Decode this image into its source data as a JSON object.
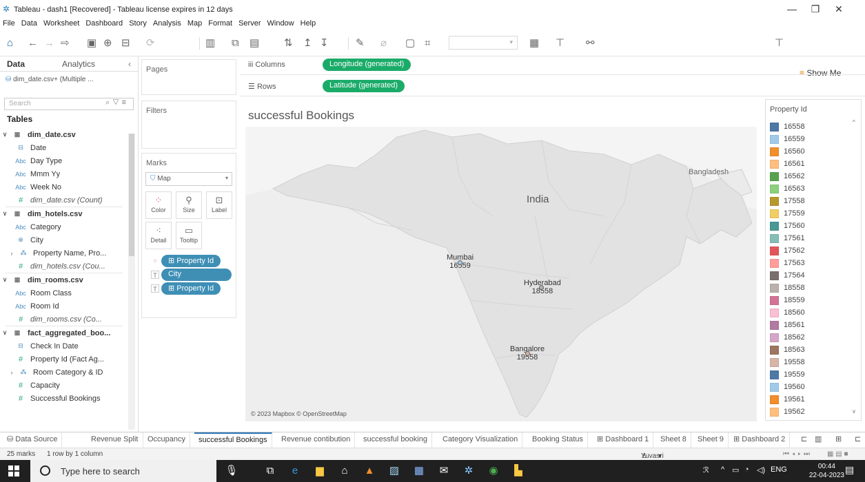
{
  "window": {
    "title": "Tableau - dash1 [Recovered] - Tableau license expires in 12 days"
  },
  "menu": [
    "File",
    "Data",
    "Worksheet",
    "Dashboard",
    "Story",
    "Analysis",
    "Map",
    "Format",
    "Server",
    "Window",
    "Help"
  ],
  "toolbar": {
    "show_me": "Show Me"
  },
  "data_pane": {
    "tab_data": "Data",
    "tab_analytics": "Analytics",
    "datasource": "dim_date.csv+ (Multiple ...",
    "search_placeholder": "Search",
    "tables_heading": "Tables"
  },
  "fields": [
    {
      "kind": "table",
      "label": "dim_date.csv",
      "chev": "∨"
    },
    {
      "kind": "date",
      "label": "Date"
    },
    {
      "kind": "dim",
      "label": "Day Type"
    },
    {
      "kind": "dim",
      "label": "Mmm Yy"
    },
    {
      "kind": "dim",
      "label": "Week No"
    },
    {
      "kind": "count",
      "label": "dim_date.csv (Count)"
    },
    {
      "kind": "table",
      "label": "dim_hotels.csv",
      "chev": "∨"
    },
    {
      "kind": "dim",
      "label": "Category"
    },
    {
      "kind": "geo",
      "label": "City"
    },
    {
      "kind": "hier",
      "label": "Property Name, Pro...",
      "chev": "›"
    },
    {
      "kind": "count",
      "label": "dim_hotels.csv (Cou..."
    },
    {
      "kind": "table",
      "label": "dim_rooms.csv",
      "chev": "∨"
    },
    {
      "kind": "dim",
      "label": "Room Class"
    },
    {
      "kind": "dim",
      "label": "Room Id"
    },
    {
      "kind": "count",
      "label": "dim_rooms.csv (Co..."
    },
    {
      "kind": "table",
      "label": "fact_aggregated_boo...",
      "chev": "∨"
    },
    {
      "kind": "date",
      "label": "Check In Date"
    },
    {
      "kind": "meas",
      "label": "Property Id (Fact Ag..."
    },
    {
      "kind": "hier",
      "label": "Room Category & ID",
      "chev": "›"
    },
    {
      "kind": "meas",
      "label": "Capacity"
    },
    {
      "kind": "meas",
      "label": "Successful Bookings"
    }
  ],
  "shelves": {
    "pages": "Pages",
    "filters": "Filters",
    "marks": "Marks",
    "mark_type": "Map",
    "color": "Color",
    "size": "Size",
    "label": "Label",
    "detail": "Detail",
    "tooltip": "Tooltip",
    "mark_pills": [
      "Property Id",
      "City",
      "Property Id"
    ],
    "columns_label": "Columns",
    "rows_label": "Rows",
    "columns_pill": "Longitude (generated)",
    "rows_pill": "Latitude (generated)"
  },
  "sheet": {
    "title": "successful Bookings",
    "credit": "© 2023 Mapbox © OpenStreetMap",
    "map_labels": {
      "country": "India",
      "neighbor": "Bangladesh"
    },
    "cities": [
      {
        "name": "Mumbai",
        "id": "16559"
      },
      {
        "name": "Hyderabad",
        "id": "18558"
      },
      {
        "name": "Bangalore",
        "id": "19558"
      }
    ]
  },
  "legend": {
    "title": "Property Id",
    "items": [
      {
        "id": "16558",
        "color": "#4e79a7"
      },
      {
        "id": "16559",
        "color": "#a0cbe8"
      },
      {
        "id": "16560",
        "color": "#f28e2b"
      },
      {
        "id": "16561",
        "color": "#ffbe7d"
      },
      {
        "id": "16562",
        "color": "#59a14f"
      },
      {
        "id": "16563",
        "color": "#8cd17d"
      },
      {
        "id": "17558",
        "color": "#b6992d"
      },
      {
        "id": "17559",
        "color": "#f1ce63"
      },
      {
        "id": "17560",
        "color": "#499894"
      },
      {
        "id": "17561",
        "color": "#86bcb6"
      },
      {
        "id": "17562",
        "color": "#e15759"
      },
      {
        "id": "17563",
        "color": "#ff9d9a"
      },
      {
        "id": "17564",
        "color": "#79706e"
      },
      {
        "id": "18558",
        "color": "#bab0ac"
      },
      {
        "id": "18559",
        "color": "#d37295"
      },
      {
        "id": "18560",
        "color": "#fabfd2"
      },
      {
        "id": "18561",
        "color": "#b07aa1"
      },
      {
        "id": "18562",
        "color": "#d4a6c8"
      },
      {
        "id": "18563",
        "color": "#9d7660"
      },
      {
        "id": "19558",
        "color": "#d7b5a6"
      },
      {
        "id": "19559",
        "color": "#4e79a7"
      },
      {
        "id": "19560",
        "color": "#a0cbe8"
      },
      {
        "id": "19561",
        "color": "#f28e2b"
      },
      {
        "id": "19562",
        "color": "#ffbe7d"
      }
    ]
  },
  "tabs": {
    "datasource": "Data Source",
    "sheets": [
      "Revenue Split",
      "Occupancy",
      "successful Bookings",
      "Revenue contibution",
      "successful booking",
      "Category Visualization",
      "Booking Status",
      "Dashboard 1",
      "Sheet 8",
      "Sheet 9",
      "Dashboard 2"
    ],
    "active": "successful Bookings"
  },
  "status": {
    "marks": "25 marks",
    "rows_cols": "1 row by 1 column",
    "user": "Yuvasri R"
  },
  "taskbar": {
    "search_placeholder": "Type here to search",
    "lang": "ENG",
    "time": "00:44",
    "date": "22-04-2023"
  }
}
